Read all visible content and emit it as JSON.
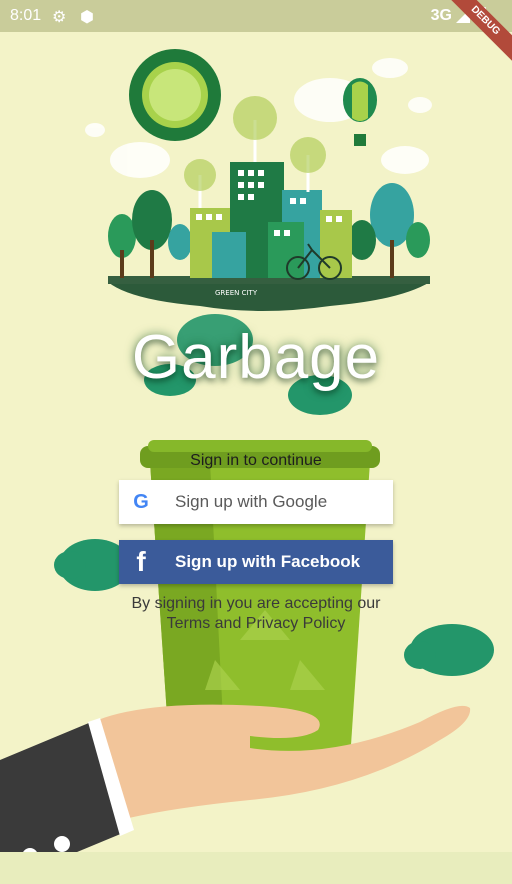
{
  "status_bar": {
    "time": "8:01",
    "network": "3G",
    "debug_label": "DEBUG"
  },
  "illustration": {
    "city_label": "GREEN CITY"
  },
  "app": {
    "title": "Garbage",
    "subtitle": "Sign in to continue"
  },
  "buttons": {
    "google_label": "Sign up with Google",
    "facebook_label": "Sign up with Facebook",
    "google_icon": "G",
    "facebook_icon": "f"
  },
  "disclaimer": {
    "line1": "By signing in you are accepting our",
    "line2": "Terms and Privacy  Policy"
  },
  "colors": {
    "background": "#f3f3c8",
    "facebook_blue": "#3b5b9a",
    "bin_green": "#8fbe2c"
  }
}
